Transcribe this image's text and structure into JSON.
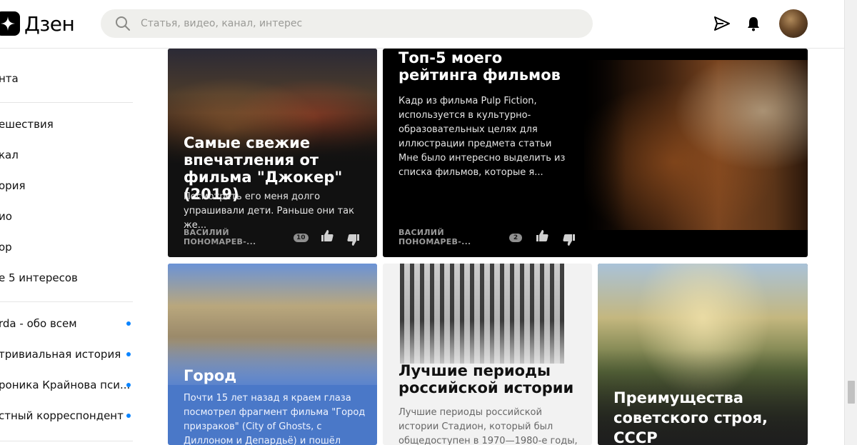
{
  "header": {
    "logo_text": "Дзен",
    "search_placeholder": "Статья, видео, канал, интерес"
  },
  "sidebar": {
    "items": [
      {
        "label": "нта"
      },
      {
        "label": "ешествия"
      },
      {
        "label": "кал"
      },
      {
        "label": "ория"
      },
      {
        "label": "ио"
      },
      {
        "label": "ор"
      },
      {
        "label": "е 5 интересов"
      },
      {
        "label": "rda - обо всем",
        "dot": true
      },
      {
        "label": "тривиальная история",
        "dot": true
      },
      {
        "label": "роника Крайнова пси...",
        "dot": true
      },
      {
        "label": "стный корреспондент",
        "dot": true
      }
    ]
  },
  "cards": [
    {
      "id": "joker",
      "title": "Самые свежие впечатления от фильма \"Джокер\" (2019)",
      "snippet": "Посмотреть его меня долго упрашивали дети. Раньше они так же...",
      "author": "ВАСИЛИЙ ПОНОМАРЕВ-...",
      "comments": "10"
    },
    {
      "id": "pulp",
      "title": "Топ-5 моего рейтинга фильмов",
      "snippet": "Кадр из фильма Pulp Fiction, используется в культурно-образовательных целях для иллюстрации предмета статьи Мне было интересно выделить из списка фильмов, которые я...",
      "author": "ВАСИЛИЙ ПОНОМАРЕВ-...",
      "comments": "2"
    },
    {
      "id": "city",
      "title": "Город",
      "snippet": "Почти 15 лет назад я краем глаза посмотрел фрагмент фильма \"Город призраков\" (City of Ghosts, с Диллоном и Депардьё) и пошёл"
    },
    {
      "id": "history",
      "title": "Лучшие периоды российской истории",
      "snippet": "Лучшие периоды российской истории Стадион, который был общедоступен в 1970—1980-е годы, вдруг оказался"
    },
    {
      "id": "ussr",
      "title": "Преимущества советского строя, СССР"
    }
  ]
}
